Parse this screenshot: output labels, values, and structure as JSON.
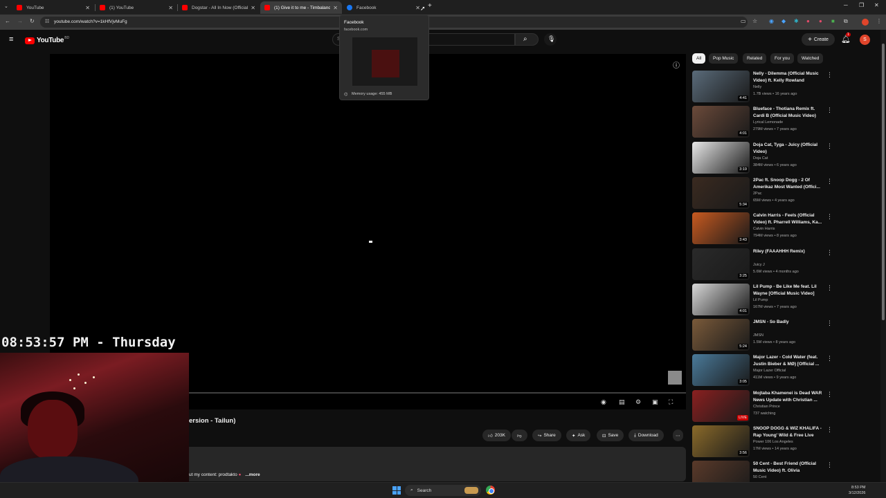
{
  "browser": {
    "tabs": [
      {
        "title": "YouTube",
        "favicon": "youtube-icon"
      },
      {
        "title": "(1) YouTube",
        "favicon": "youtube-icon"
      },
      {
        "title": "Dogstar - All In Now (Official M",
        "favicon": "youtube-icon"
      },
      {
        "title": "(1) Give it to me - Timbaland(2",
        "favicon": "youtube-icon"
      },
      {
        "title": "Facebook",
        "favicon": "facebook-icon"
      }
    ],
    "url": "youtube.com/watch?v=1kHfVjvMuFg",
    "hover_card": {
      "title": "Facebook",
      "url": "facebook.com",
      "memory": "Memory usage: 455 MB"
    }
  },
  "youtube": {
    "logo_text": "YouTube",
    "logo_region": "BD",
    "create_label": "Create",
    "notification_count": "1",
    "avatar_letter": "S",
    "search_placeholder": "S",
    "video_title": "ersion - Tailun)",
    "actions": {
      "likes": "203K",
      "share": "Share",
      "ask": "Ask",
      "save": "Save",
      "download": "Download"
    },
    "description": {
      "text": "ut my content: prodtakto",
      "more": "...more"
    },
    "chips": [
      "All",
      "Pop Music",
      "Related",
      "For you",
      "Watched"
    ],
    "recommendations": [
      {
        "title": "Nelly - Dilemma (Official Music Video) ft. Kelly Rowland",
        "channel": "Nelly",
        "meta": "1.7B views • 16 years ago",
        "duration": "4:41"
      },
      {
        "title": "Blueface - Thotiana Remix ft. Cardi B (Official Music Video)",
        "channel": "Lyrical Lemonade",
        "meta": "279M views • 7 years ago",
        "duration": "4:01"
      },
      {
        "title": "Doja Cat, Tyga - Juicy (Official Video)",
        "channel": "Doja Cat",
        "meta": "384M views • 6 years ago",
        "duration": "3:19"
      },
      {
        "title": "2Pac ft. Snoop Dogg - 2 Of Amerikaz Most Wanted (Offici...",
        "channel": "2Pac",
        "meta": "65M views • 4 years ago",
        "duration": "5:34"
      },
      {
        "title": "Calvin Harris - Feels (Official Video) ft. Pharrell Williams, Ka...",
        "channel": "Calvin Harris",
        "meta": "794M views • 8 years ago",
        "duration": "3:43"
      },
      {
        "title": "Riley (FAAAHHH Remix)",
        "channel": "Juicy J",
        "meta": "5.6M views • 4 months ago",
        "duration": "3:25"
      },
      {
        "title": "Lil Pump - Be Like Me feat. Lil Wayne [Official Music Video]",
        "channel": "Lil Pump",
        "meta": "167M views • 7 years ago",
        "duration": "4:01"
      },
      {
        "title": "JMSN - So Badly",
        "channel": "JMSN",
        "meta": "1.5M views • 8 years ago",
        "duration": "5:24"
      },
      {
        "title": "Major Lazer - Cold Water (feat. Justin Bieber & MØ) [Official ...",
        "channel": "Major Lazer Official",
        "meta": "411M views • 9 years ago",
        "duration": "3:05"
      },
      {
        "title": "Mojtaba Khamenei is Dead WAR News Update with Christian ...",
        "channel": "Christian Prince",
        "meta": "737 watching",
        "duration": "LIVE"
      },
      {
        "title": "SNOOP DOGG & WIZ KHALIFA - Rap Young' Wild & Free Live",
        "channel": "Power 106 Los Angeles",
        "meta": "17M views • 14 years ago",
        "duration": "3:56"
      },
      {
        "title": "50 Cent - Best Friend (Official Music Video) ft. Olivia",
        "channel": "50 Cent",
        "meta": "",
        "duration": ""
      }
    ],
    "thumb_colors": [
      "#5a6b7a",
      "#6b4a3a",
      "#e8e8e8",
      "#3a2a20",
      "#c85a20",
      "#2a2a2a",
      "#d8d8d8",
      "#7a5a3a",
      "#4a7a9a",
      "#8a2020",
      "#8a6a2a",
      "#5a3a2a"
    ]
  },
  "overlay": {
    "clock": "08:53:57 PM - Thursday"
  },
  "taskbar": {
    "search_label": "Search",
    "time": "8:53 PM",
    "date": "3/12/2026"
  }
}
